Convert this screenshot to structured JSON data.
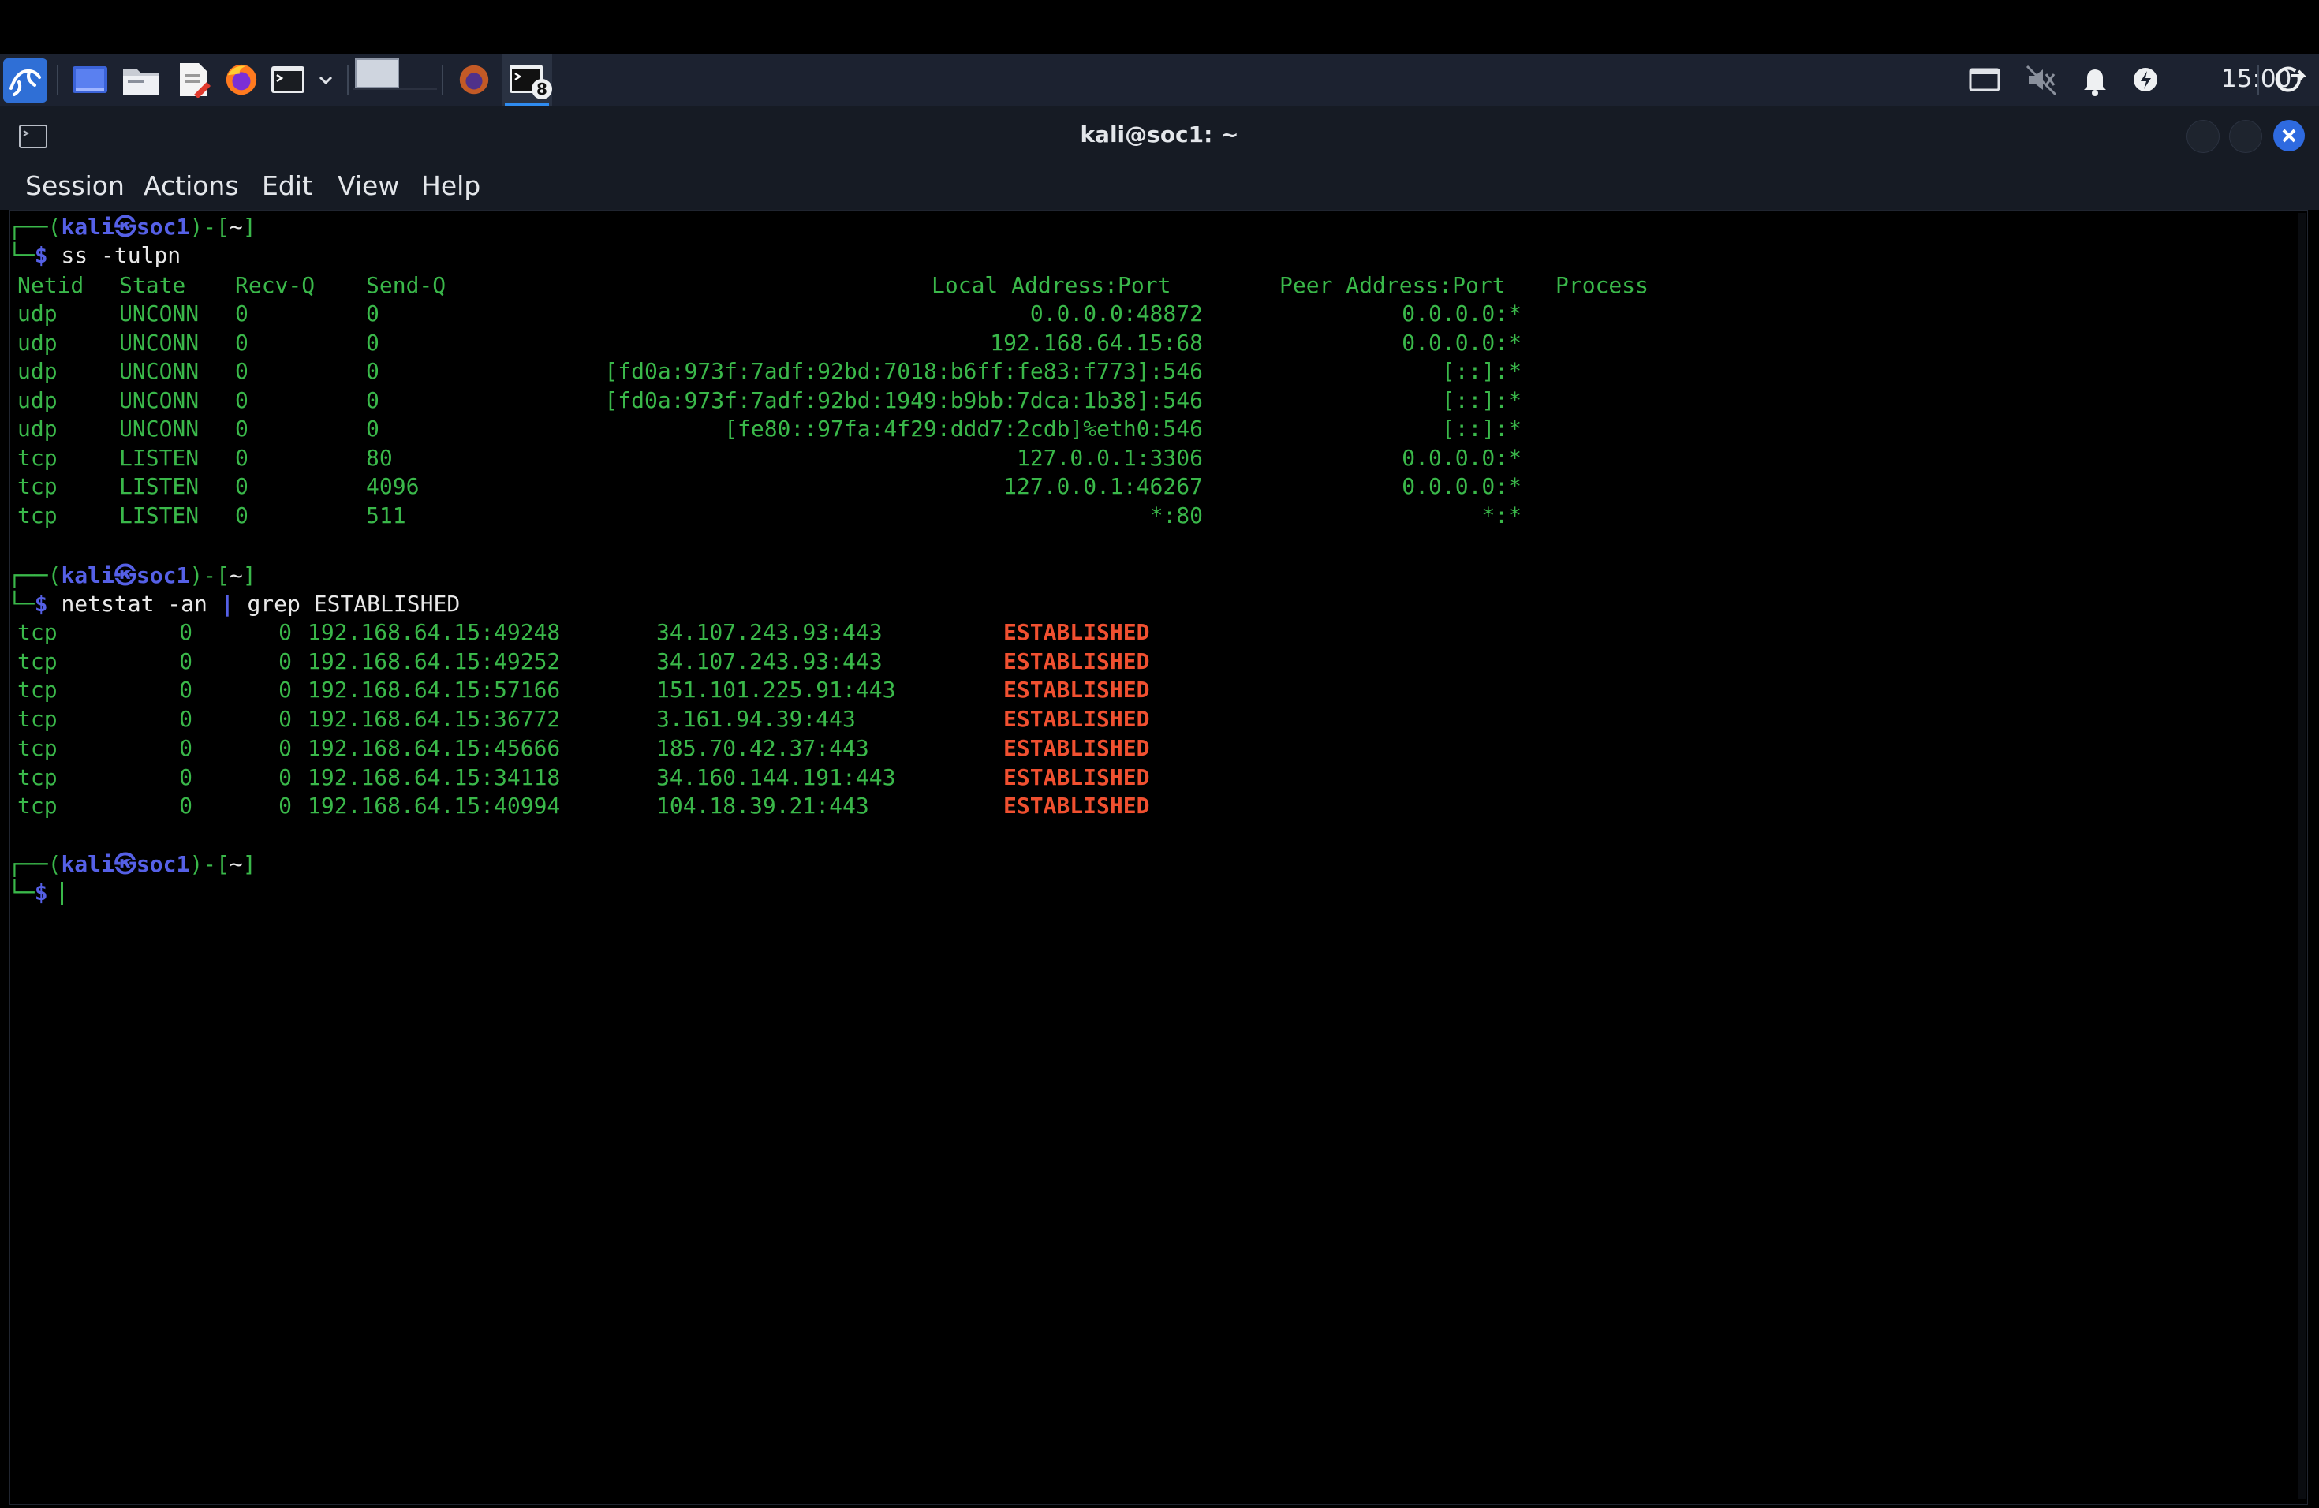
{
  "panel": {
    "clock": "15:00",
    "terminal_badge": "8",
    "icons": [
      "kali-menu-icon",
      "show-desktop-icon",
      "files-icon",
      "text-editor-icon",
      "firefox-icon",
      "terminal-icon",
      "chevron-down-icon",
      "workspace-icon",
      "firefox-task-icon",
      "terminal-task-icon",
      "screen-icon",
      "mute-icon",
      "bell-icon",
      "power-manager-icon",
      "logout-icon"
    ]
  },
  "window": {
    "title": "kali@soc1: ~",
    "menu": [
      "Session",
      "Actions",
      "Edit",
      "View",
      "Help"
    ]
  },
  "terminal": {
    "user": "kali",
    "host": "soc1",
    "path": "~",
    "prompt_symbol": "$",
    "cmd1": "ss -tulpn",
    "ss_header": [
      "Netid",
      "State",
      "Recv-Q",
      "Send-Q",
      "Local Address:Port",
      "Peer Address:Port",
      "Process"
    ],
    "ss_rows": [
      [
        "udp",
        "UNCONN",
        "0",
        "0",
        "0.0.0.0:48872",
        "0.0.0.0:*"
      ],
      [
        "udp",
        "UNCONN",
        "0",
        "0",
        "192.168.64.15:68",
        "0.0.0.0:*"
      ],
      [
        "udp",
        "UNCONN",
        "0",
        "0",
        "[fd0a:973f:7adf:92bd:7018:b6ff:fe83:f773]:546",
        "[::]:*"
      ],
      [
        "udp",
        "UNCONN",
        "0",
        "0",
        "[fd0a:973f:7adf:92bd:1949:b9bb:7dca:1b38]:546",
        "[::]:*"
      ],
      [
        "udp",
        "UNCONN",
        "0",
        "0",
        "[fe80::97fa:4f29:ddd7:2cdb]%eth0:546",
        "[::]:*"
      ],
      [
        "tcp",
        "LISTEN",
        "0",
        "80",
        "127.0.0.1:3306",
        "0.0.0.0:*"
      ],
      [
        "tcp",
        "LISTEN",
        "0",
        "4096",
        "127.0.0.1:46267",
        "0.0.0.0:*"
      ],
      [
        "tcp",
        "LISTEN",
        "0",
        "511",
        "*:80",
        "*:*"
      ]
    ],
    "cmd2_a": "netstat -an",
    "cmd2_pipe": "|",
    "cmd2_b": "grep ESTABLISHED",
    "ns_rows": [
      [
        "tcp",
        "0",
        "0",
        "192.168.64.15:49248",
        "34.107.243.93:443",
        "ESTABLISHED"
      ],
      [
        "tcp",
        "0",
        "0",
        "192.168.64.15:49252",
        "34.107.243.93:443",
        "ESTABLISHED"
      ],
      [
        "tcp",
        "0",
        "0",
        "192.168.64.15:57166",
        "151.101.225.91:443",
        "ESTABLISHED"
      ],
      [
        "tcp",
        "0",
        "0",
        "192.168.64.15:36772",
        "3.161.94.39:443",
        "ESTABLISHED"
      ],
      [
        "tcp",
        "0",
        "0",
        "192.168.64.15:45666",
        "185.70.42.37:443",
        "ESTABLISHED"
      ],
      [
        "tcp",
        "0",
        "0",
        "192.168.64.15:34118",
        "34.160.144.191:443",
        "ESTABLISHED"
      ],
      [
        "tcp",
        "0",
        "0",
        "192.168.64.15:40994",
        "104.18.39.21:443",
        "ESTABLISHED"
      ]
    ]
  },
  "colors": {
    "output_green": "#3ab84a",
    "prompt_blue": "#5560e6",
    "established_red": "#f05030",
    "panel_bg": "#1c2230",
    "close_button": "#2e6ae0"
  }
}
